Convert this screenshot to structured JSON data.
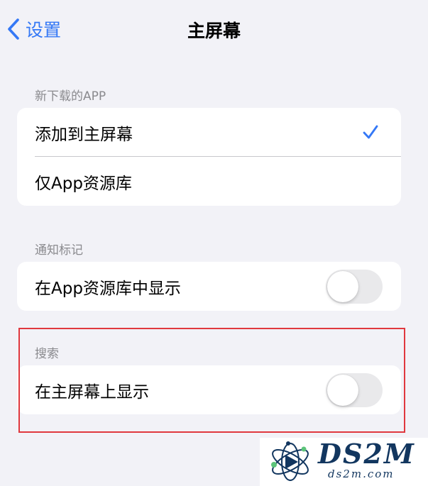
{
  "nav": {
    "back_label": "设置",
    "title": "主屏幕"
  },
  "sections": [
    {
      "header": "新下载的APP",
      "rows": [
        {
          "label": "添加到主屏幕",
          "selected": true
        },
        {
          "label": "仅App资源库",
          "selected": false
        }
      ]
    },
    {
      "header": "通知标记",
      "rows": [
        {
          "label": "在App资源库中显示",
          "toggle_on": false
        }
      ]
    },
    {
      "header": "搜索",
      "rows": [
        {
          "label": "在主屏幕上显示",
          "toggle_on": false
        }
      ]
    }
  ],
  "watermark": {
    "brand": "DS2M",
    "url": "ds2m.com"
  },
  "colors": {
    "accent": "#3478f6",
    "highlight": "#e0383e",
    "background": "#f2f2f7",
    "toggle_off": "#e9e9eb"
  }
}
